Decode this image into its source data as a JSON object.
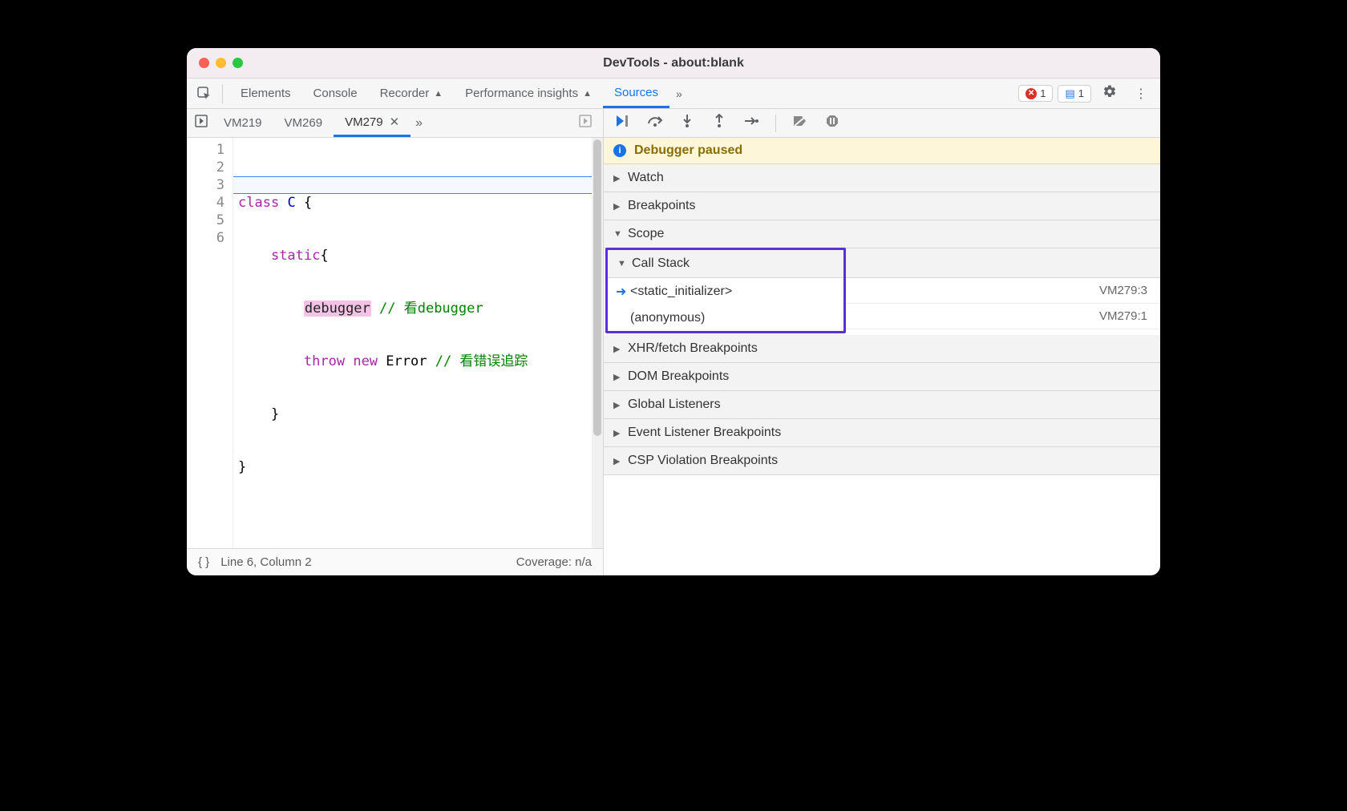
{
  "window": {
    "title": "DevTools - about:blank"
  },
  "main_tabs": {
    "elements": "Elements",
    "console": "Console",
    "recorder": "Recorder",
    "perf": "Performance insights",
    "sources": "Sources"
  },
  "badges": {
    "error_count": "1",
    "message_count": "1"
  },
  "source_tabs": {
    "vm219": "VM219",
    "vm269": "VM269",
    "vm279": "VM279"
  },
  "code": {
    "line_numbers": [
      "1",
      "2",
      "3",
      "4",
      "5",
      "6"
    ],
    "l1_class": "class",
    "l1_name": "C",
    "l1_brace": " {",
    "l2_static": "static",
    "l2_brace": "{",
    "l3_debugger": "debugger",
    "l3_comment": " // 看debugger",
    "l4_throw": "throw",
    "l4_new": "new",
    "l4_error": "Error",
    "l4_comment": " // 看错误追踪",
    "l5": "    }",
    "l6": "}"
  },
  "statusbar": {
    "pos": "Line 6, Column 2",
    "coverage": "Coverage: n/a"
  },
  "debugger": {
    "paused_msg": "Debugger paused",
    "sections": {
      "watch": "Watch",
      "breakpoints": "Breakpoints",
      "scope": "Scope",
      "call_stack": "Call Stack",
      "xhr": "XHR/fetch Breakpoints",
      "dom": "DOM Breakpoints",
      "global": "Global Listeners",
      "event": "Event Listener Breakpoints",
      "csp": "CSP Violation Breakpoints"
    },
    "call_stack": [
      {
        "name": "<static_initializer>",
        "loc": "VM279:3"
      },
      {
        "name": "(anonymous)",
        "loc": "VM279:1"
      }
    ]
  }
}
